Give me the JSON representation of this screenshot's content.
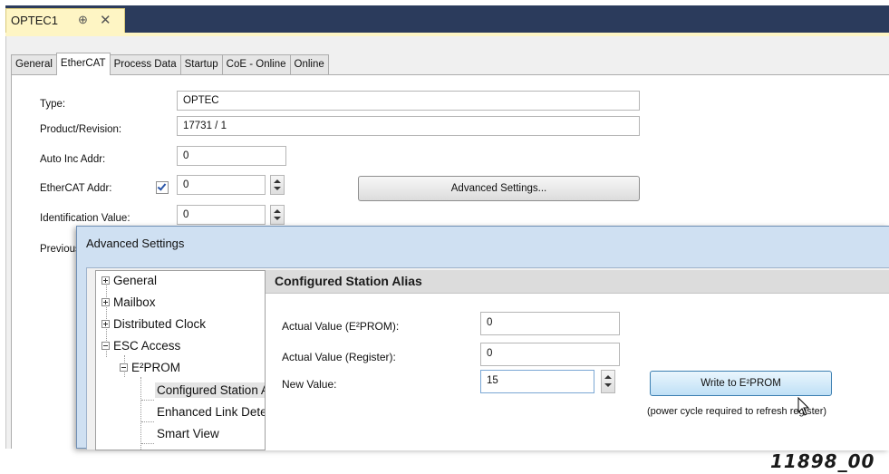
{
  "doc_tab": {
    "title": "OPTEC1",
    "pin_glyph": "⊕",
    "close_glyph": "✕"
  },
  "tabs": [
    "General",
    "EtherCAT",
    "Process Data",
    "Startup",
    "CoE - Online",
    "Online"
  ],
  "active_tab": "EtherCAT",
  "form": {
    "type_label": "Type:",
    "type_value": "OPTEC",
    "product_label": "Product/Revision:",
    "product_value": "17731 / 1",
    "autoinc_label": "Auto Inc Addr:",
    "autoinc_value": "0",
    "ethercat_addr_label": "EtherCAT Addr:",
    "ethercat_addr_checked": true,
    "ethercat_addr_value": "0",
    "advanced_button": "Advanced Settings...",
    "identification_label": "Identification Value:",
    "identification_value": "0",
    "previous_label": "Previous Port:"
  },
  "dialog": {
    "title": "Advanced Settings",
    "tree": [
      {
        "label": "General",
        "expander": "plus"
      },
      {
        "label": "Mailbox",
        "expander": "plus"
      },
      {
        "label": "Distributed Clock",
        "expander": "plus"
      },
      {
        "label": "ESC Access",
        "expander": "minus"
      },
      {
        "label": "E²PROM",
        "expander": "minus"
      },
      {
        "label": "Configured Station Alias",
        "selected": true
      },
      {
        "label": "Enhanced Link Detection"
      },
      {
        "label": "Smart View"
      }
    ],
    "section_title": "Configured Station Alias",
    "actual_eeprom_label": "Actual Value (E²PROM):",
    "actual_eeprom_value": "0",
    "actual_register_label": "Actual Value (Register):",
    "actual_register_value": "0",
    "new_value_label": "New Value:",
    "new_value": "15",
    "write_button": "Write to E²PROM",
    "note": "(power cycle required to refresh register)"
  },
  "watermark": "11898_00",
  "colors": {
    "topbar": "#2b3b5c",
    "doc_tab": "#fef5c4",
    "dialog_frame": "#cfe0f2",
    "write_button_border": "#3c7fb1"
  }
}
